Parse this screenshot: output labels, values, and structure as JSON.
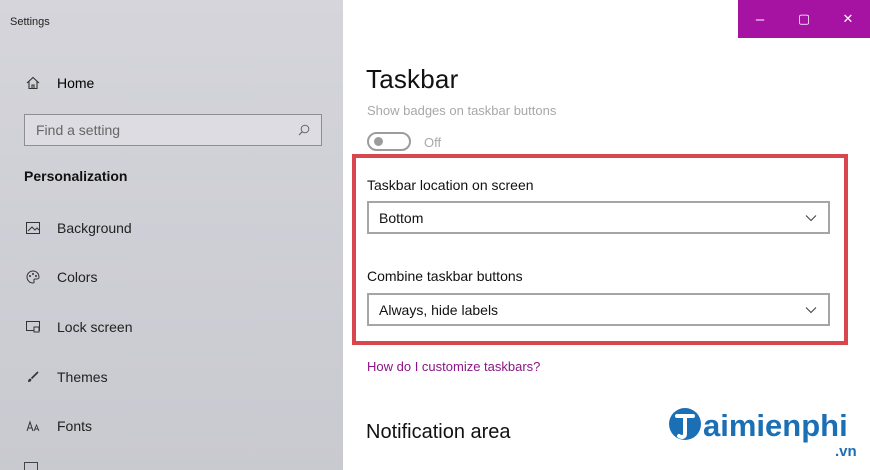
{
  "window": {
    "title": "Settings",
    "controls": {
      "minimize": "–",
      "maximize": "▢",
      "close": "✕"
    },
    "accent_color": "#a612a2"
  },
  "sidebar": {
    "home": {
      "icon": "home-icon",
      "label": "Home"
    },
    "search": {
      "placeholder": "Find a setting",
      "icon": "search-icon"
    },
    "section_heading": "Personalization",
    "items": [
      {
        "icon": "background-icon",
        "label": "Background"
      },
      {
        "icon": "colors-icon",
        "label": "Colors"
      },
      {
        "icon": "lock-screen-icon",
        "label": "Lock screen"
      },
      {
        "icon": "themes-icon",
        "label": "Themes"
      },
      {
        "icon": "fonts-icon",
        "label": "Fonts"
      }
    ]
  },
  "main": {
    "title": "Taskbar",
    "badges_setting": {
      "label": "Show badges on taskbar buttons",
      "state": "Off",
      "enabled": false
    },
    "highlight_color": "#d7474b",
    "location": {
      "label": "Taskbar location on screen",
      "value": "Bottom"
    },
    "combine": {
      "label": "Combine taskbar buttons",
      "value": "Always, hide labels"
    },
    "help_link": "How do I customize taskbars?",
    "notification_heading": "Notification area"
  },
  "watermark": {
    "text": "aimienphi",
    "initial": "T",
    "suffix": ".vn",
    "color": "#1b6fb5"
  }
}
